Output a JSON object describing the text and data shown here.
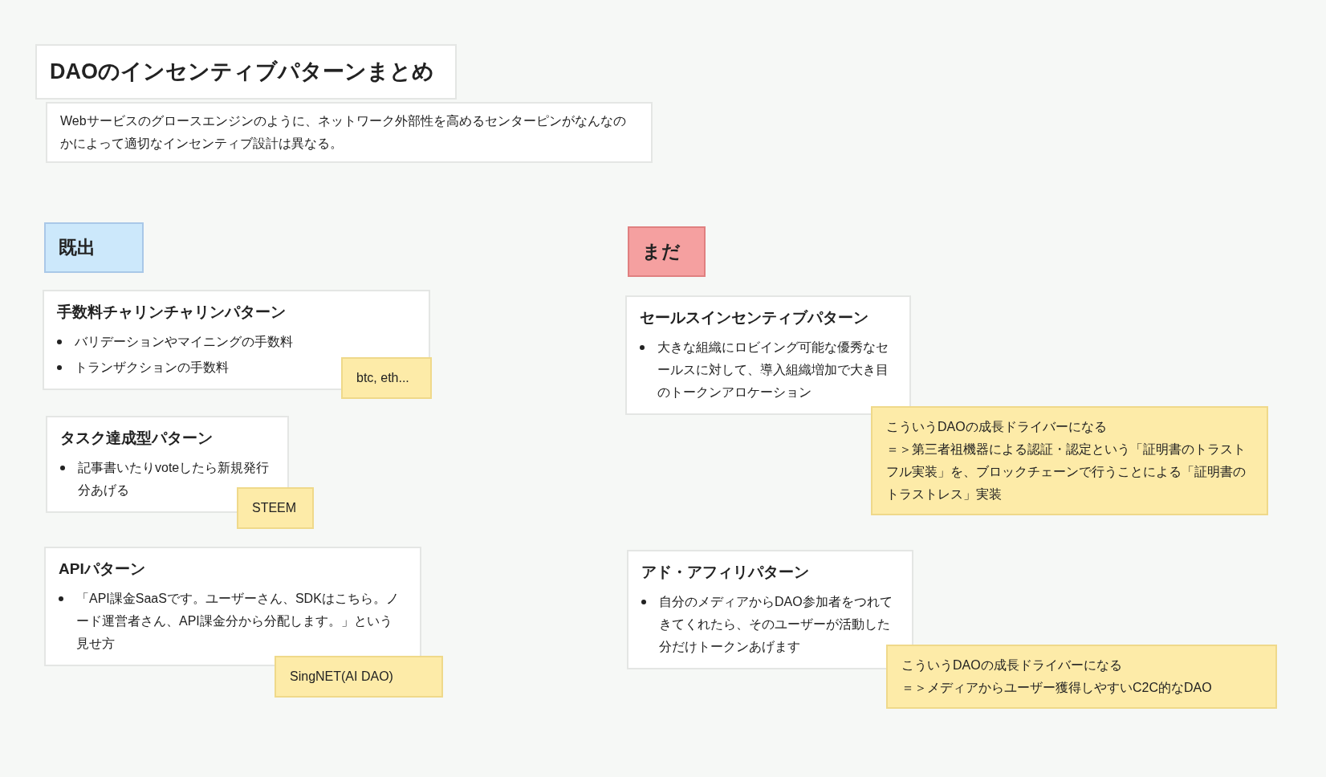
{
  "title": "DAOのインセンティブパターンまとめ",
  "description": "Webサービスのグロースエンジンのように、ネットワーク外部性を高めるセンターピンがなんなのかによって適切なインセンティブ設計は異なる。",
  "sections": [
    {
      "label": "既出",
      "color": "#cce8fb",
      "cards": [
        {
          "title": "手数料チャリンチャリンパターン",
          "bullets": [
            "バリデーションやマイニングの手数料",
            "トランザクションの手数料"
          ],
          "note": "btc, eth..."
        },
        {
          "title": "タスク達成型パターン",
          "bullets": [
            "記事書いたりvoteしたら新規発行分あげる"
          ],
          "note": "STEEM"
        },
        {
          "title": "APIパターン",
          "bullets": [
            "「API課金SaaSです。ユーザーさん、SDKはこちら。ノード運営者さん、API課金分から分配します。」という見せ方"
          ],
          "note": "SingNET(AI DAO)"
        }
      ]
    },
    {
      "label": "まだ",
      "color": "#f5a0a0",
      "cards": [
        {
          "title": "セールスインセンティブパターン",
          "bullets": [
            "大きな組織にロビイング可能な優秀なセールスに対して、導入組織増加で大き目のトークンアロケーション"
          ],
          "note": [
            "こういうDAOの成長ドライバーになる",
            "＝＞第三者祖機器による認証・認定という「証明書のトラストフル実装」を、ブロックチェーンで行うことによる「証明書のトラストレス」実装"
          ]
        },
        {
          "title": "アド・アフィリパターン",
          "bullets": [
            "自分のメディアからDAO参加者をつれてきてくれたら、そのユーザーが活動した分だけトークンあげます"
          ],
          "note": [
            "こういうDAOの成長ドライバーになる",
            "＝＞メディアからユーザー獲得しやすいC2C的なDAO"
          ]
        }
      ]
    }
  ]
}
